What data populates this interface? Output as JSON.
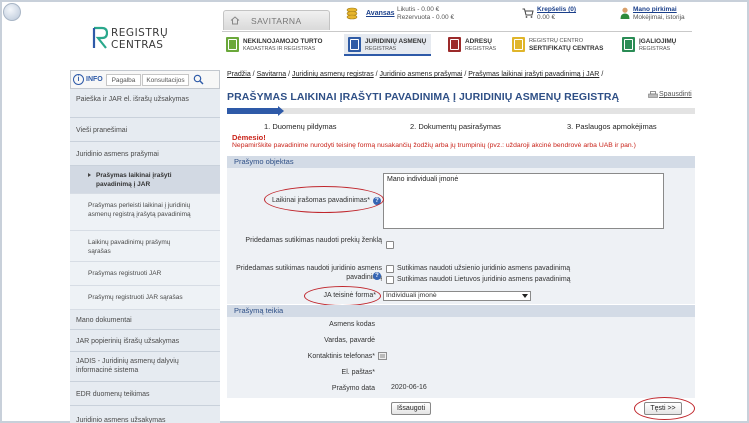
{
  "header": {
    "logo_line1": "REGISTRŲ",
    "logo_line2": "CENTRAS",
    "savitarna_label": "SAVITARNA",
    "avansas_label": "Avansas",
    "likutis": "Likutis - 0.00 €",
    "rezervuota": "Rezervuota - 0.00 €",
    "krepselis_label": "Krepšelis (0)",
    "krepselis_sum": "0.00 €",
    "pirkimai_label": "Mano pirkimai",
    "pirkimai_sub": "Mokėjimai, istorija"
  },
  "tabs": [
    {
      "line1": "NEKILNOJAMOJO TURTO",
      "line2": "KADASTRAS IR REGISTRAS",
      "color": "#6aa83a"
    },
    {
      "line1": "JURIDINIŲ ASMENŲ",
      "line2": "REGISTRAS",
      "color": "#2f5ba5"
    },
    {
      "line1": "ADRESŲ",
      "line2": "REGISTRAS",
      "color": "#9c2a2a"
    },
    {
      "line1": "REGISTRŲ CENTRO",
      "line2": "SERTIFIKATŲ CENTRAS",
      "color": "#e0b52a"
    },
    {
      "line1": "ĮGALIOJIMŲ",
      "line2": "REGISTRAS",
      "color": "#2a8c55"
    }
  ],
  "sidebar": {
    "info": "INFO",
    "pagalba": "Pagalba",
    "konsultacijos": "Konsultacijos",
    "items": [
      "Paieška ir JAR el. išrašų užsakymas",
      "Vieši pranešimai",
      "Juridinio asmens prašymai",
      "Prašymas laikinai įrašyti pavadinimą į JAR",
      "Prašymas perleisti laikinai į juridinių asmenų registrą įrašytą pavadinimą",
      "Laikinų pavadinimų prašymų sąrašas",
      "Prašymas registruoti JAR",
      "Prašymų registruoti JAR sąrašas",
      "Mano dokumentai",
      "JAR popierinių išrašų užsakymas",
      "JADIS - Juridinių asmenų dalyvių informacinė sistema",
      "EDR duomenų teikimas",
      "Juridinio asmens užsakymas"
    ]
  },
  "breadcrumb": {
    "items": [
      "Pradžia",
      "Savitarna",
      "Juridinių asmenų registras",
      "Juridinio asmens prašymai",
      "Prašymas laikinai įrašyti pavadinimą į JAR"
    ],
    "sep": " / "
  },
  "page": {
    "title": "PRAŠYMAS LAIKINAI ĮRAŠYTI PAVADINIMĄ Į JURIDINIŲ ASMENŲ REGISTRĄ",
    "print": "Spausdinti",
    "steps": [
      "1. Duomenų pildymas",
      "2. Dokumentų pasirašymas",
      "3. Paslaugos apmokėjimas"
    ],
    "progress_current_step": 1,
    "warning_title": "Dėmesio!",
    "warning_text": "Nepamirškite pavadinime nurodyti teisinę formą nusakančių žodžių arba jų trumpinių (pvz.: uždaroji akcinė bendrovė arba UAB ir pan.)"
  },
  "form": {
    "section1": "Prašymo objektas",
    "name_label": "Laikinai įrašomas pavadinimas*",
    "name_value": "Mano individuali įmonė",
    "consent1_label": "Pridedamas sutikimas naudoti prekių ženklą",
    "consent2_label": "Pridedamas sutikimas naudoti juridinio asmens pavadinimą",
    "consent2_opt1": "Sutikimas naudoti užsienio juridinio asmens pavadinimą",
    "consent2_opt2": "Sutikimas naudoti Lietuvos juridinio asmens pavadinimą",
    "legal_form_label": "JA teisinė forma*",
    "legal_form_value": "Individuali įmonė",
    "section2": "Prašymą teikia",
    "person_code_label": "Asmens kodas",
    "name_surname_label": "Vardas, pavardė",
    "phone_label": "Kontaktinis telefonas*",
    "email_label": "El. paštas*",
    "date_label": "Prašymo data",
    "date_value": "2020-06-16",
    "save_button": "Išsaugoti",
    "next_button": "Tęsti >>"
  },
  "colors": {
    "title_blue": "#2e4f86",
    "accent_blue": "#2e5aa8",
    "warning_red": "#c9231a",
    "annotation_red": "#c0272d"
  }
}
